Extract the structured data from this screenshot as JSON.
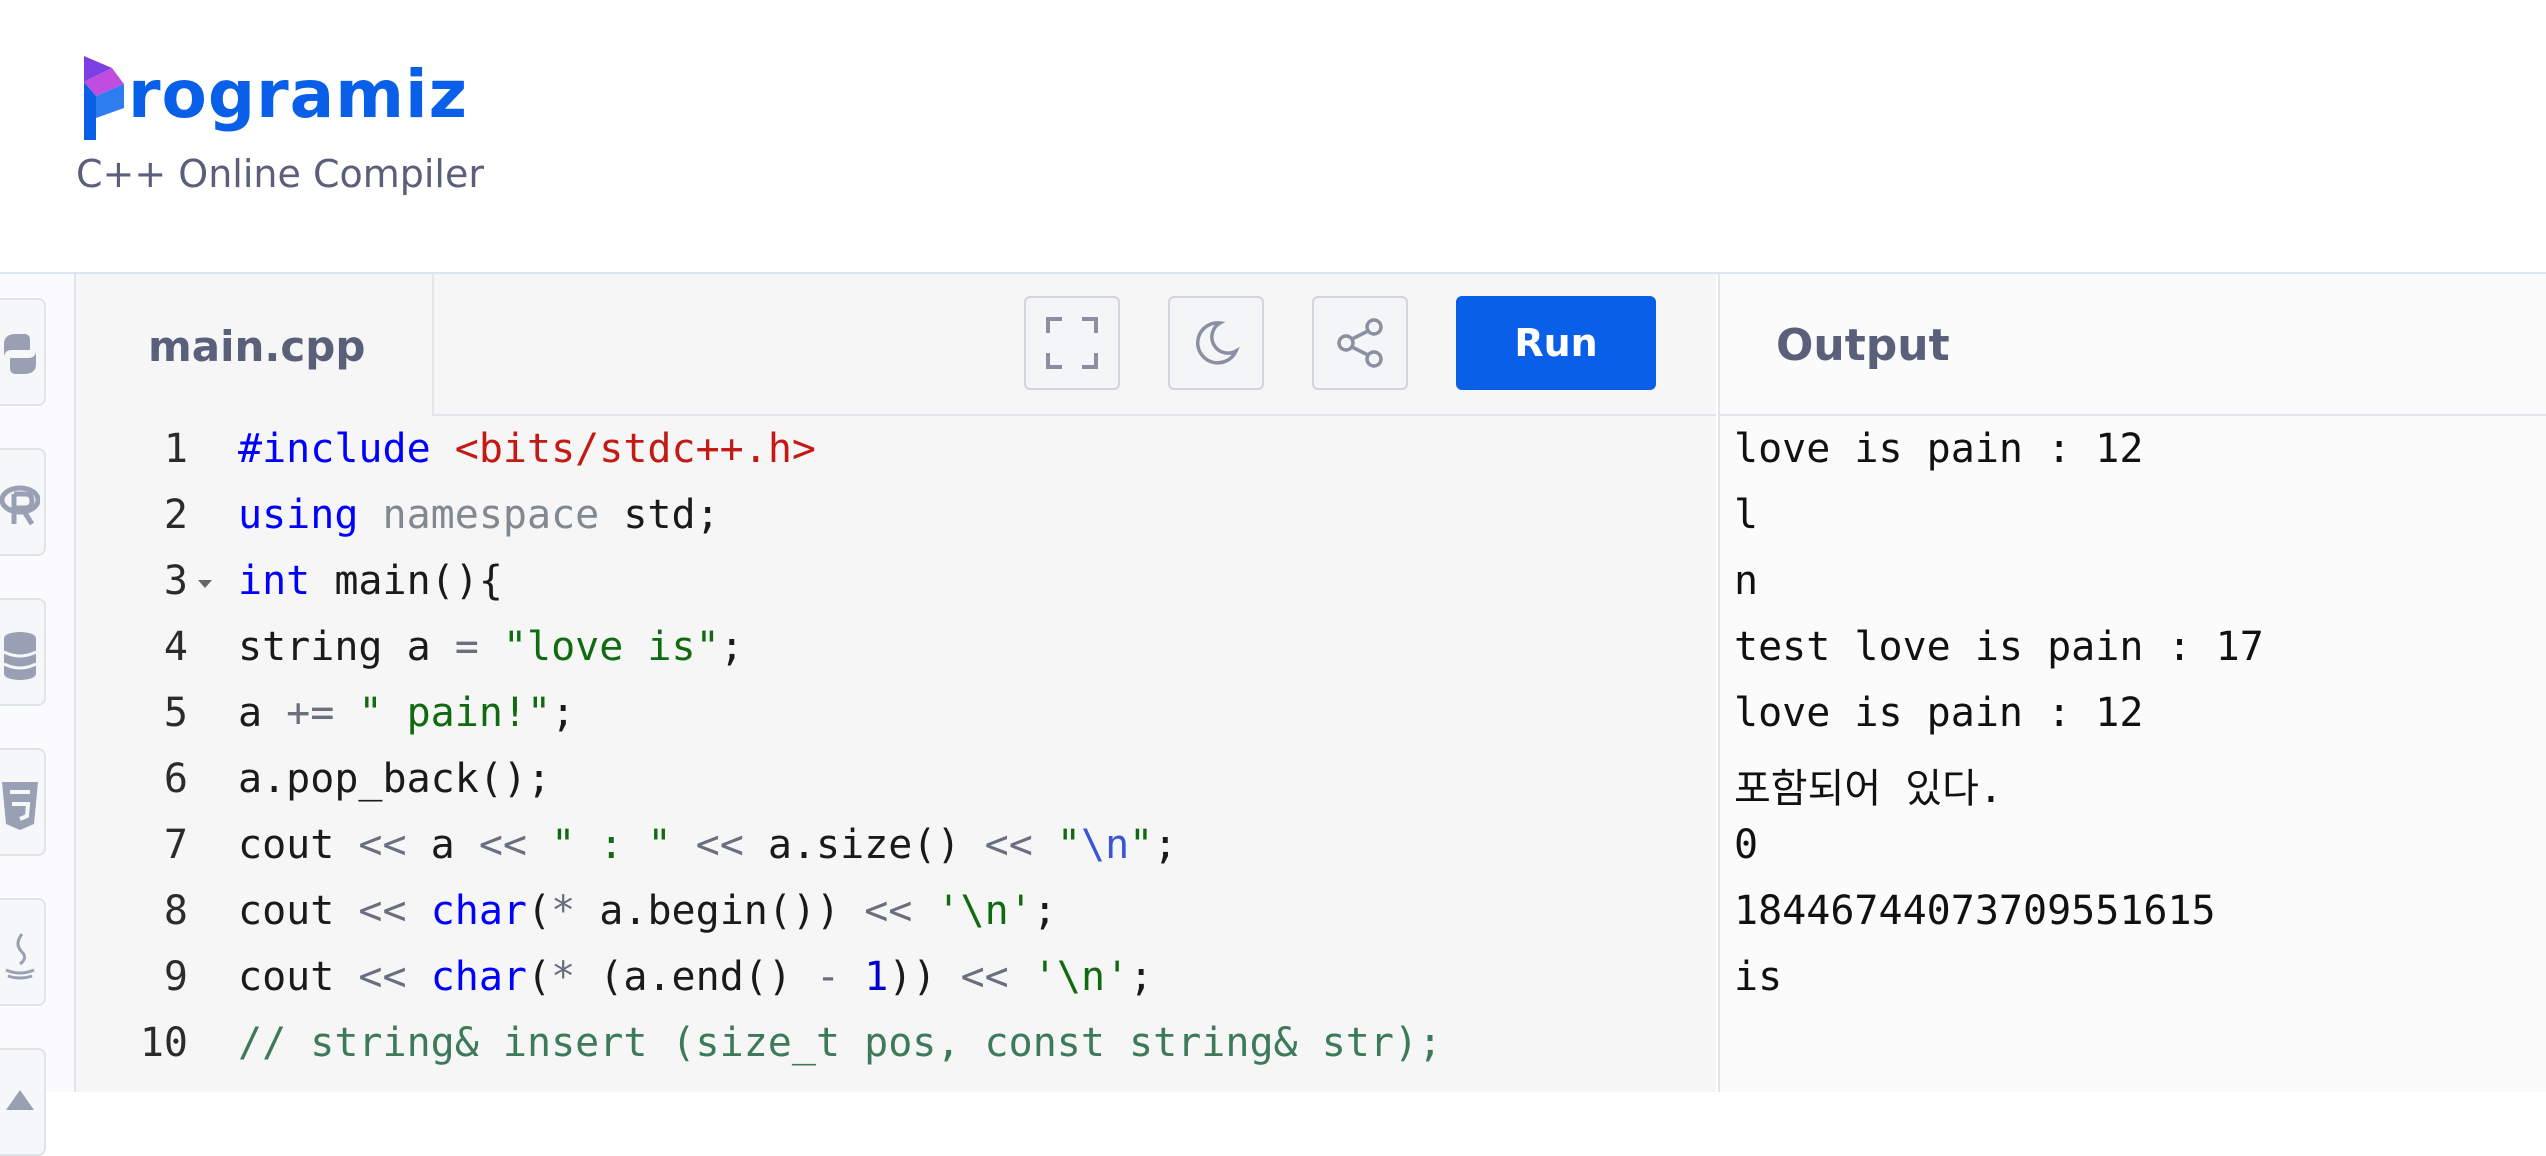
{
  "brand": {
    "logo_text": "rogramiz",
    "logo_color": "#0a5fe8",
    "subtitle": "C++ Online Compiler"
  },
  "language_bar": {
    "icons": [
      "python-icon",
      "r-icon",
      "sql-icon",
      "html-icon",
      "java-icon",
      "other-icon"
    ]
  },
  "editor": {
    "file_tab": "main.cpp",
    "toolbar": {
      "fullscreen_icon": "fullscreen-icon",
      "theme_icon": "moon-icon",
      "share_icon": "share-icon",
      "run_label": "Run",
      "run_color": "#0a5fe8"
    },
    "lines": [
      {
        "num": "1",
        "fold": false,
        "tokens": [
          {
            "t": "#include ",
            "c": "kw"
          },
          {
            "t": "<bits/stdc++.h>",
            "c": "inc"
          }
        ]
      },
      {
        "num": "2",
        "fold": false,
        "tokens": [
          {
            "t": "using ",
            "c": "kw"
          },
          {
            "t": "namespace",
            "c": "kw2"
          },
          {
            "t": " std;",
            "c": ""
          }
        ]
      },
      {
        "num": "3",
        "fold": true,
        "tokens": [
          {
            "t": "int",
            "c": "kw"
          },
          {
            "t": " main(){",
            "c": ""
          }
        ]
      },
      {
        "num": "4",
        "fold": false,
        "tokens": [
          {
            "t": "string a ",
            "c": ""
          },
          {
            "t": "=",
            "c": "op"
          },
          {
            "t": " ",
            "c": ""
          },
          {
            "t": "\"love is\"",
            "c": "str"
          },
          {
            "t": ";",
            "c": ""
          }
        ]
      },
      {
        "num": "5",
        "fold": false,
        "tokens": [
          {
            "t": "a ",
            "c": ""
          },
          {
            "t": "+=",
            "c": "op"
          },
          {
            "t": " ",
            "c": ""
          },
          {
            "t": "\" pain!\"",
            "c": "str"
          },
          {
            "t": ";",
            "c": ""
          }
        ]
      },
      {
        "num": "6",
        "fold": false,
        "tokens": [
          {
            "t": "a.pop_back();",
            "c": ""
          }
        ]
      },
      {
        "num": "7",
        "fold": false,
        "tokens": [
          {
            "t": "cout ",
            "c": ""
          },
          {
            "t": "<<",
            "c": "op"
          },
          {
            "t": " a ",
            "c": ""
          },
          {
            "t": "<<",
            "c": "op"
          },
          {
            "t": " ",
            "c": ""
          },
          {
            "t": "\" : \"",
            "c": "str"
          },
          {
            "t": " ",
            "c": ""
          },
          {
            "t": "<<",
            "c": "op"
          },
          {
            "t": " a.size() ",
            "c": ""
          },
          {
            "t": "<<",
            "c": "op"
          },
          {
            "t": " ",
            "c": ""
          },
          {
            "t": "\"",
            "c": "str"
          },
          {
            "t": "\\n",
            "c": "esc"
          },
          {
            "t": "\"",
            "c": "str"
          },
          {
            "t": ";",
            "c": ""
          }
        ]
      },
      {
        "num": "8",
        "fold": false,
        "tokens": [
          {
            "t": "cout ",
            "c": ""
          },
          {
            "t": "<<",
            "c": "op"
          },
          {
            "t": " ",
            "c": ""
          },
          {
            "t": "char",
            "c": "kw"
          },
          {
            "t": "(",
            "c": ""
          },
          {
            "t": "*",
            "c": "op"
          },
          {
            "t": " a.begin()) ",
            "c": ""
          },
          {
            "t": "<<",
            "c": "op"
          },
          {
            "t": " ",
            "c": ""
          },
          {
            "t": "'\\n'",
            "c": "str"
          },
          {
            "t": ";",
            "c": ""
          }
        ]
      },
      {
        "num": "9",
        "fold": false,
        "tokens": [
          {
            "t": "cout ",
            "c": ""
          },
          {
            "t": "<<",
            "c": "op"
          },
          {
            "t": " ",
            "c": ""
          },
          {
            "t": "char",
            "c": "kw"
          },
          {
            "t": "(",
            "c": ""
          },
          {
            "t": "*",
            "c": "op"
          },
          {
            "t": " (a.end() ",
            "c": ""
          },
          {
            "t": "-",
            "c": "op"
          },
          {
            "t": " ",
            "c": ""
          },
          {
            "t": "1",
            "c": "num"
          },
          {
            "t": ")) ",
            "c": ""
          },
          {
            "t": "<<",
            "c": "op"
          },
          {
            "t": " ",
            "c": ""
          },
          {
            "t": "'\\n'",
            "c": "str"
          },
          {
            "t": ";",
            "c": ""
          }
        ]
      },
      {
        "num": "10",
        "fold": false,
        "tokens": [
          {
            "t": "// string& insert (size_t pos, const string& str);",
            "c": "cmt"
          }
        ]
      }
    ]
  },
  "output": {
    "title": "Output",
    "lines": [
      "love is pain : 12",
      "l",
      "n",
      "test love is pain : 17",
      "love is pain : 12",
      "포함되어 있다.",
      "0",
      "18446744073709551615",
      "is"
    ]
  }
}
